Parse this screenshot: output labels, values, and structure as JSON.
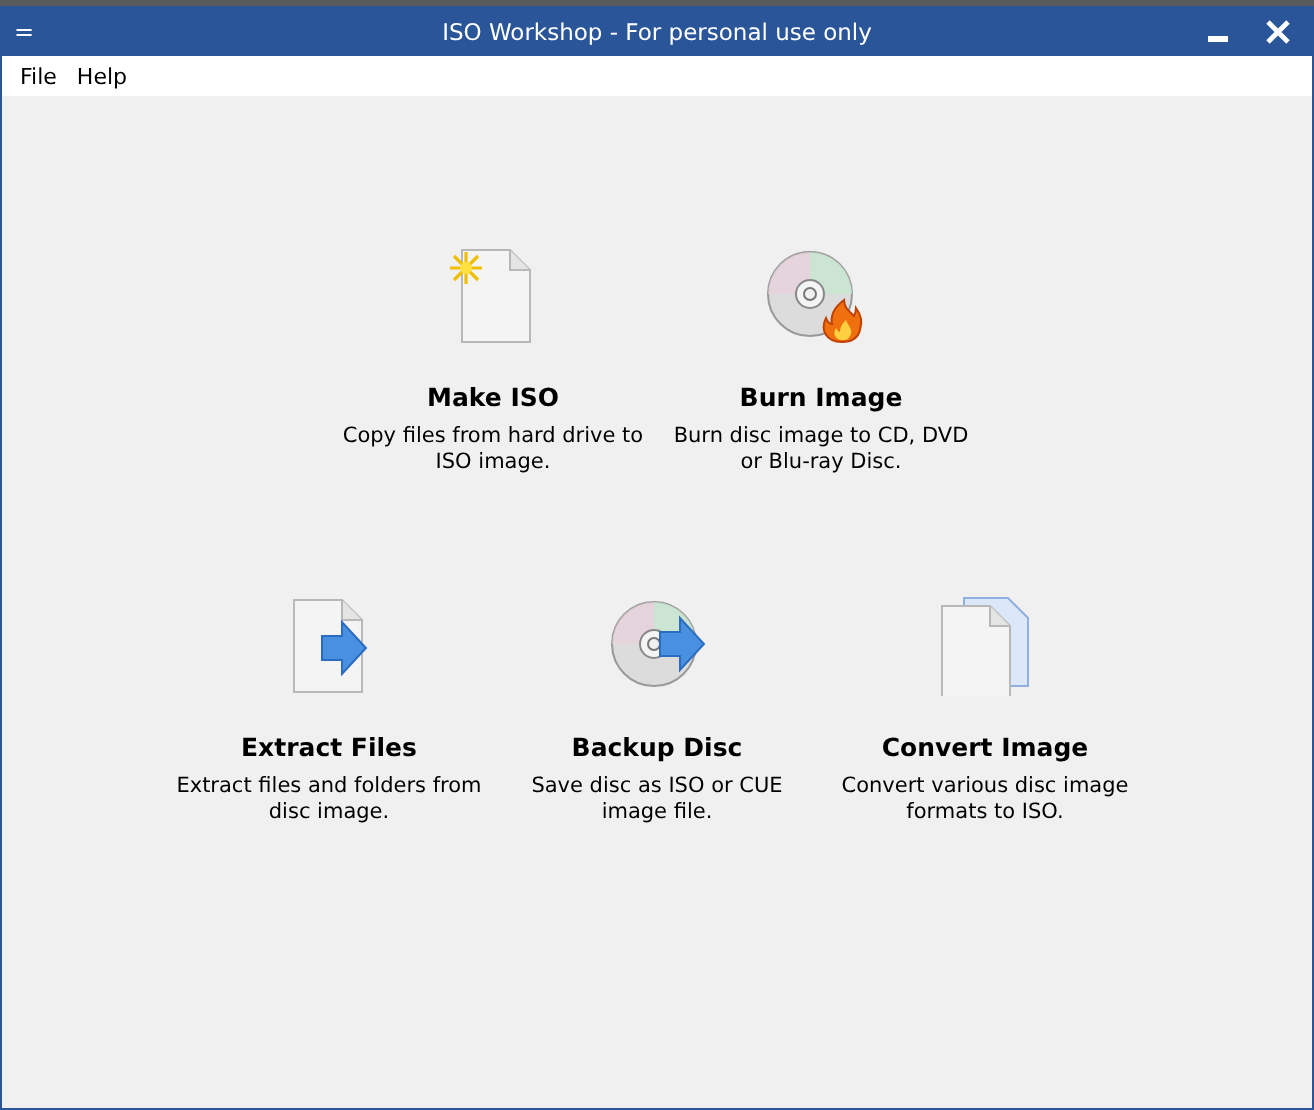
{
  "window": {
    "title": "ISO Workshop - For personal use only",
    "menu_glyph": "="
  },
  "menu": [
    "File",
    "Help"
  ],
  "task_rows": [
    [
      {
        "kind": "new-file",
        "title": "Make ISO",
        "description": "Copy files from hard drive to\nISO image."
      },
      {
        "kind": "burn-disc",
        "title": "Burn Image",
        "description": "Burn disc image to CD, DVD\nor Blu-ray Disc."
      }
    ],
    [
      {
        "kind": "extract",
        "title": "Extract Files",
        "description": "Extract files and folders from\ndisc image."
      },
      {
        "kind": "backup",
        "title": "Backup Disc",
        "description": "Save disc as ISO or CUE\nimage file."
      },
      {
        "kind": "convert",
        "title": "Convert Image",
        "description": "Convert various disc image\nformats to ISO."
      }
    ]
  ]
}
